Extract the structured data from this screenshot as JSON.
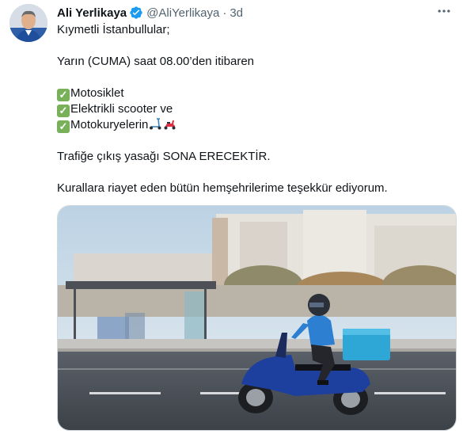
{
  "author": {
    "name": "Ali Yerlikaya",
    "handle": "@AliYerlikaya",
    "separator": "·",
    "time": "3d"
  },
  "tweet": {
    "line1": "Kıymetli İstanbullular;",
    "line2": "Yarın (CUMA) saat 08.00’den itibaren",
    "checklist": [
      {
        "label": "Motosiklet"
      },
      {
        "label": "Elektrikli scooter ve"
      },
      {
        "label": "Motokuryelerin"
      }
    ],
    "line3": "Trafiğe çıkış yasağı SONA ERECEKTİR.",
    "line4": "Kurallara riayet eden bütün hemşehrilerime teşekkür ediyorum."
  },
  "icons": {
    "verified": "verified-badge-icon",
    "more": "more-icon",
    "check": "check-mark-button-icon",
    "scooter": "kick-scooter-icon",
    "motor_scooter": "motor-scooter-icon"
  },
  "colors": {
    "text": "#0f1419",
    "secondary": "#536471",
    "verified": "#1d9bf0",
    "check_green": "#78b159",
    "border": "#cfd9de"
  }
}
